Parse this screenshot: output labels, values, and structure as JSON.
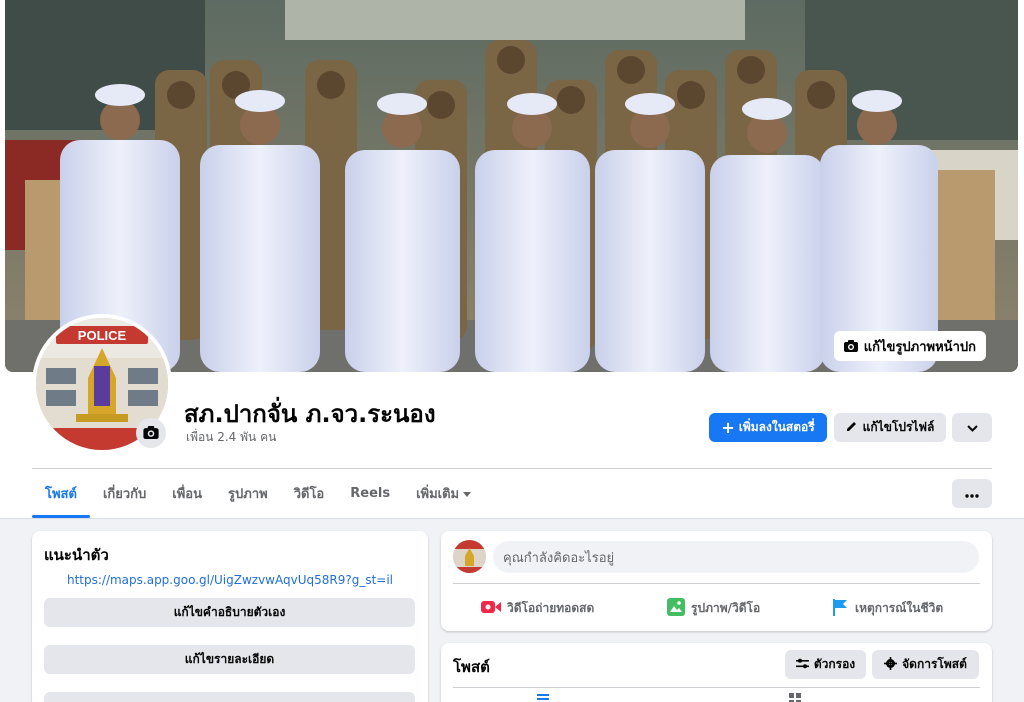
{
  "cover": {
    "edit_label": "แก้ไขรูปภาพหน้าปก",
    "avatar_sign_text": "POLICE"
  },
  "profile": {
    "name": "สภ.ปากจั่น ภ.จว.ระนอง",
    "friends": "เพื่อน 2.4 พัน คน"
  },
  "actions": {
    "add_story": "เพิ่มลงในสตอรี่",
    "edit_profile": "แก้ไขโปรไฟล์"
  },
  "tabs": [
    {
      "label": "โพสต์"
    },
    {
      "label": "เกี่ยวกับ"
    },
    {
      "label": "เพื่อน"
    },
    {
      "label": "รูปภาพ"
    },
    {
      "label": "วิดีโอ"
    },
    {
      "label": "Reels"
    },
    {
      "label": "เพิ่มเติม"
    }
  ],
  "intro": {
    "title": "แนะนำตัว",
    "link": "https://maps.app.goo.gl/UigZwzvwAqvUq58R9?g_st=il",
    "edit_bio": "แก้ไขคำอธิบายตัวเอง",
    "edit_details": "แก้ไขรายละเอียด"
  },
  "composer": {
    "placeholder": "คุณกำลังคิดอะไรอยู่",
    "live_video": "วิดีโอถ่ายทอดสด",
    "photo_video": "รูปภาพ/วิดีโอ",
    "life_event": "เหตุการณ์ในชีวิต"
  },
  "posts": {
    "title": "โพสต์",
    "filters": "ตัวกรอง",
    "manage": "จัดการโพสต์"
  },
  "colors": {
    "accent": "#1877f2",
    "background": "#f0f2f5",
    "live": "#f02849",
    "photo": "#45bd62",
    "event": "#1d9bf0"
  }
}
